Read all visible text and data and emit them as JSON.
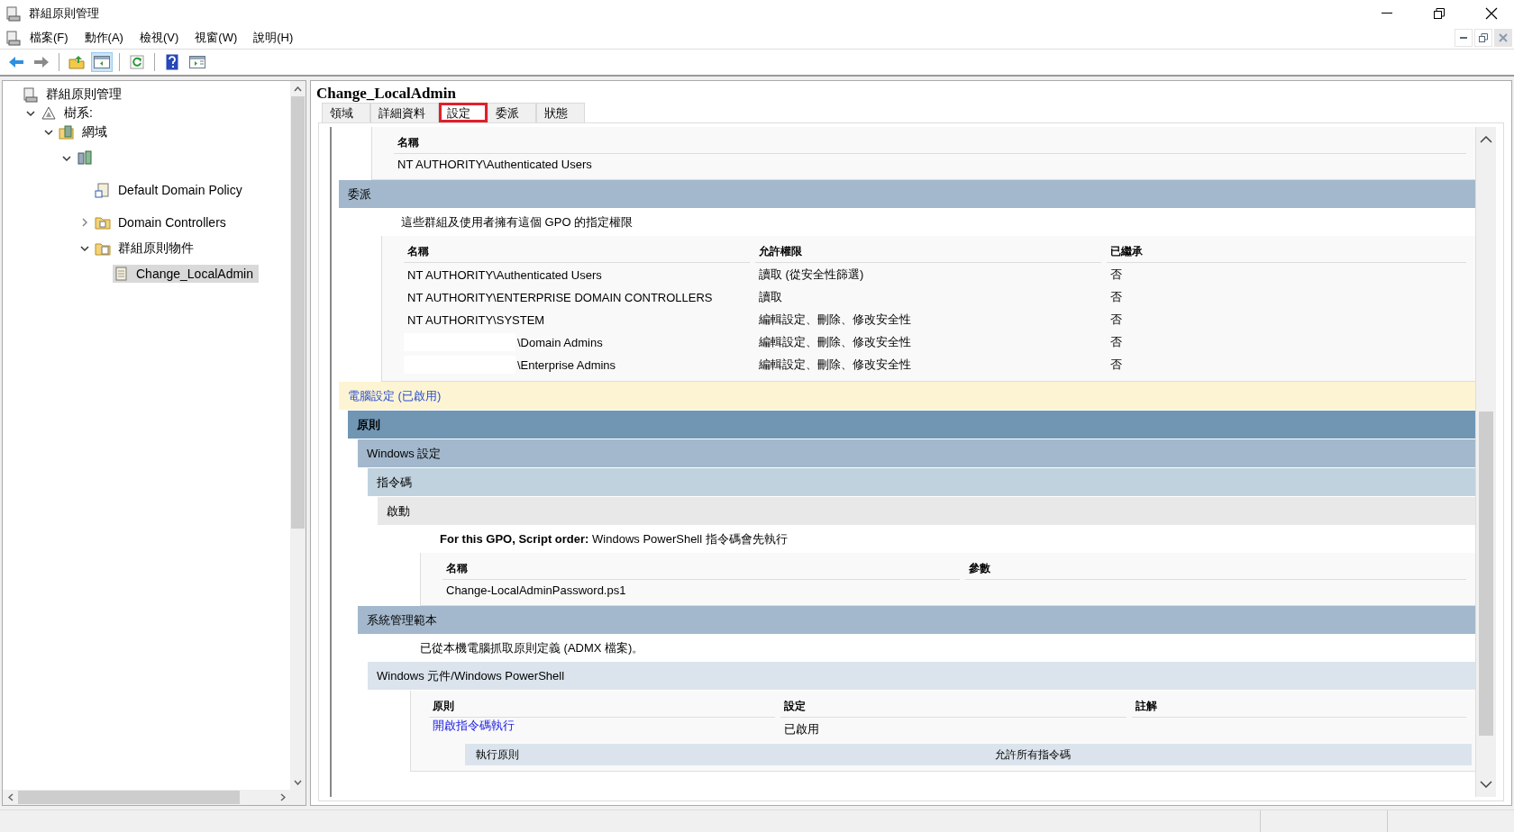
{
  "window": {
    "title": "群組原則管理"
  },
  "menu": [
    "檔案(F)",
    "動作(A)",
    "檢視(V)",
    "視窗(W)",
    "說明(H)"
  ],
  "tree": [
    {
      "label": "群組原則管理",
      "kind": "console",
      "selected": false,
      "children": [
        {
          "label": "樹系:",
          "kind": "forest",
          "expanded": true,
          "selected": false,
          "children": [
            {
              "label": "網域",
              "kind": "domains",
              "expanded": true,
              "selected": false,
              "children": [
                {
                  "kind": "domain",
                  "expanded": true,
                  "selected": false,
                  "children": [
                    {
                      "label": "Default Domain Policy",
                      "kind": "link",
                      "selected": false
                    },
                    {
                      "label": "Domain Controllers",
                      "kind": "unit",
                      "expanded": false,
                      "selected": false
                    },
                    {
                      "label": "群組原則物件",
                      "kind": "folder",
                      "expanded": true,
                      "selected": false,
                      "children": [
                        {
                          "label": "Change_LocalAdmin",
                          "kind": "object",
                          "selected": true
                        }
                      ]
                    }
                  ]
                }
              ]
            }
          ]
        }
      ]
    }
  ],
  "details": {
    "title": "Change_LocalAdmin",
    "tabs": [
      {
        "label": "領域",
        "selected": false,
        "highlighted": false
      },
      {
        "label": "詳細資料",
        "selected": false,
        "highlighted": false
      },
      {
        "label": "設定",
        "selected": true,
        "highlighted": true
      },
      {
        "label": "委派",
        "selected": false,
        "highlighted": false
      },
      {
        "label": "狀態",
        "selected": false,
        "highlighted": false
      }
    ],
    "report": [
      {
        "kind": "table",
        "columns": [
          "名稱"
        ],
        "rows": [
          {
            "cells": [
              "NT AUTHORITY\\Authenticated Users"
            ],
            "redacted": false
          }
        ]
      },
      {
        "kind": "category",
        "heading": "委派",
        "children": [
          {
            "kind": "note",
            "text": "這些群組及使用者擁有這個 GPO 的指定權限"
          },
          {
            "kind": "table",
            "columns": [
              "名稱",
              "允許權限",
              "已繼承"
            ],
            "rows": [
              {
                "cells": [
                  "NT AUTHORITY\\Authenticated Users",
                  "讀取 (從安全性篩選)",
                  "否"
                ],
                "redacted": false
              },
              {
                "cells": [
                  "NT AUTHORITY\\ENTERPRISE DOMAIN CONTROLLERS",
                  "讀取",
                  "否"
                ],
                "redacted": false
              },
              {
                "cells": [
                  "NT AUTHORITY\\SYSTEM",
                  "編輯設定、刪除、修改安全性",
                  "否"
                ],
                "redacted": false
              },
              {
                "cells": [
                  "\\Domain Admins",
                  "編輯設定、刪除、修改安全性",
                  "否"
                ],
                "redacted": true
              },
              {
                "cells": [
                  "\\Enterprise Admins",
                  "編輯設定、刪除、修改安全性",
                  "否"
                ],
                "redacted": true
              }
            ]
          }
        ]
      },
      {
        "kind": "scope",
        "heading": "電腦設定 (已啟用)",
        "children": [
          {
            "kind": "policy",
            "heading": "原則",
            "children": [
              {
                "kind": "category",
                "heading": "Windows 設定",
                "children": [
                  {
                    "kind": "subcategory",
                    "heading": "指令碼",
                    "children": [
                      {
                        "kind": "group",
                        "heading": "啟動",
                        "children": [
                          {
                            "kind": "note",
                            "text": "**For this GPO, Script order:** Windows PowerShell 指令碼會先執行"
                          },
                          {
                            "kind": "table",
                            "columns": [
                              "名稱",
                              "參數"
                            ],
                            "rows": [
                              {
                                "cells": [
                                  "Change-LocalAdminPassword.ps1"
                                ],
                                "redacted": false
                              }
                            ]
                          }
                        ]
                      }
                    ]
                  }
                ]
              },
              {
                "kind": "category",
                "heading": "系統管理範本",
                "children": [
                  {
                    "kind": "note",
                    "text": "已從本機電腦抓取原則定義 (ADMX 檔案)。"
                  },
                  {
                    "kind": "setting",
                    "heading": "Windows 元件/Windows PowerShell",
                    "children": [
                      {
                        "kind": "policy-table",
                        "columns": [
                          "原則",
                          "設定",
                          "註解"
                        ],
                        "rows": [
                          {
                            "policy": "開啟指令碼執行",
                            "setting": "已啟用",
                            "details": [
                              {
                                "label": "執行原則",
                                "value": "允許所有指令碼"
                              }
                            ]
                          }
                        ]
                      }
                    ]
                  }
                ]
              }
            ]
          }
        ]
      }
    ]
  }
}
